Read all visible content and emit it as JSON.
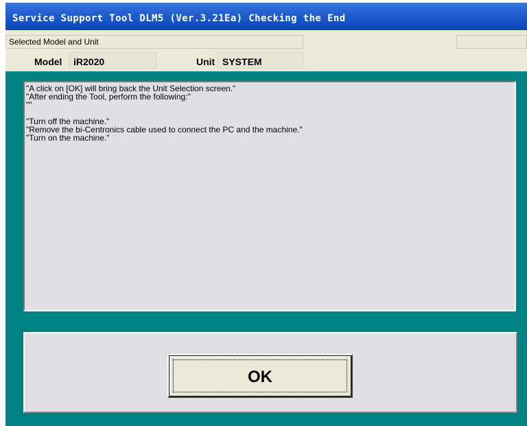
{
  "window": {
    "title": "Service Support Tool DLM5 (Ver.3.21Ea) Checking the End",
    "colors": {
      "background": "#008080",
      "titlebar": "#1f5fcf",
      "panel": "#e1dfe3",
      "face": "#ece9d8"
    }
  },
  "info": {
    "section_label": "Selected Model and Unit",
    "model_label": "Model",
    "model_value": "iR2020",
    "unit_label": "Unit",
    "unit_value": "SYSTEM"
  },
  "message": {
    "lines": [
      "\"A click on [OK] will bring back the Unit Selection screen.\"",
      "\"After ending the Tool, perform the following:\"",
      "\"\"",
      "",
      "\"Turn off the machine.\"",
      "\"Remove the bi-Centronics cable used to connect the PC and the machine.\"",
      "\"Turn on the machine.\""
    ]
  },
  "buttons": {
    "ok_label": "OK"
  }
}
